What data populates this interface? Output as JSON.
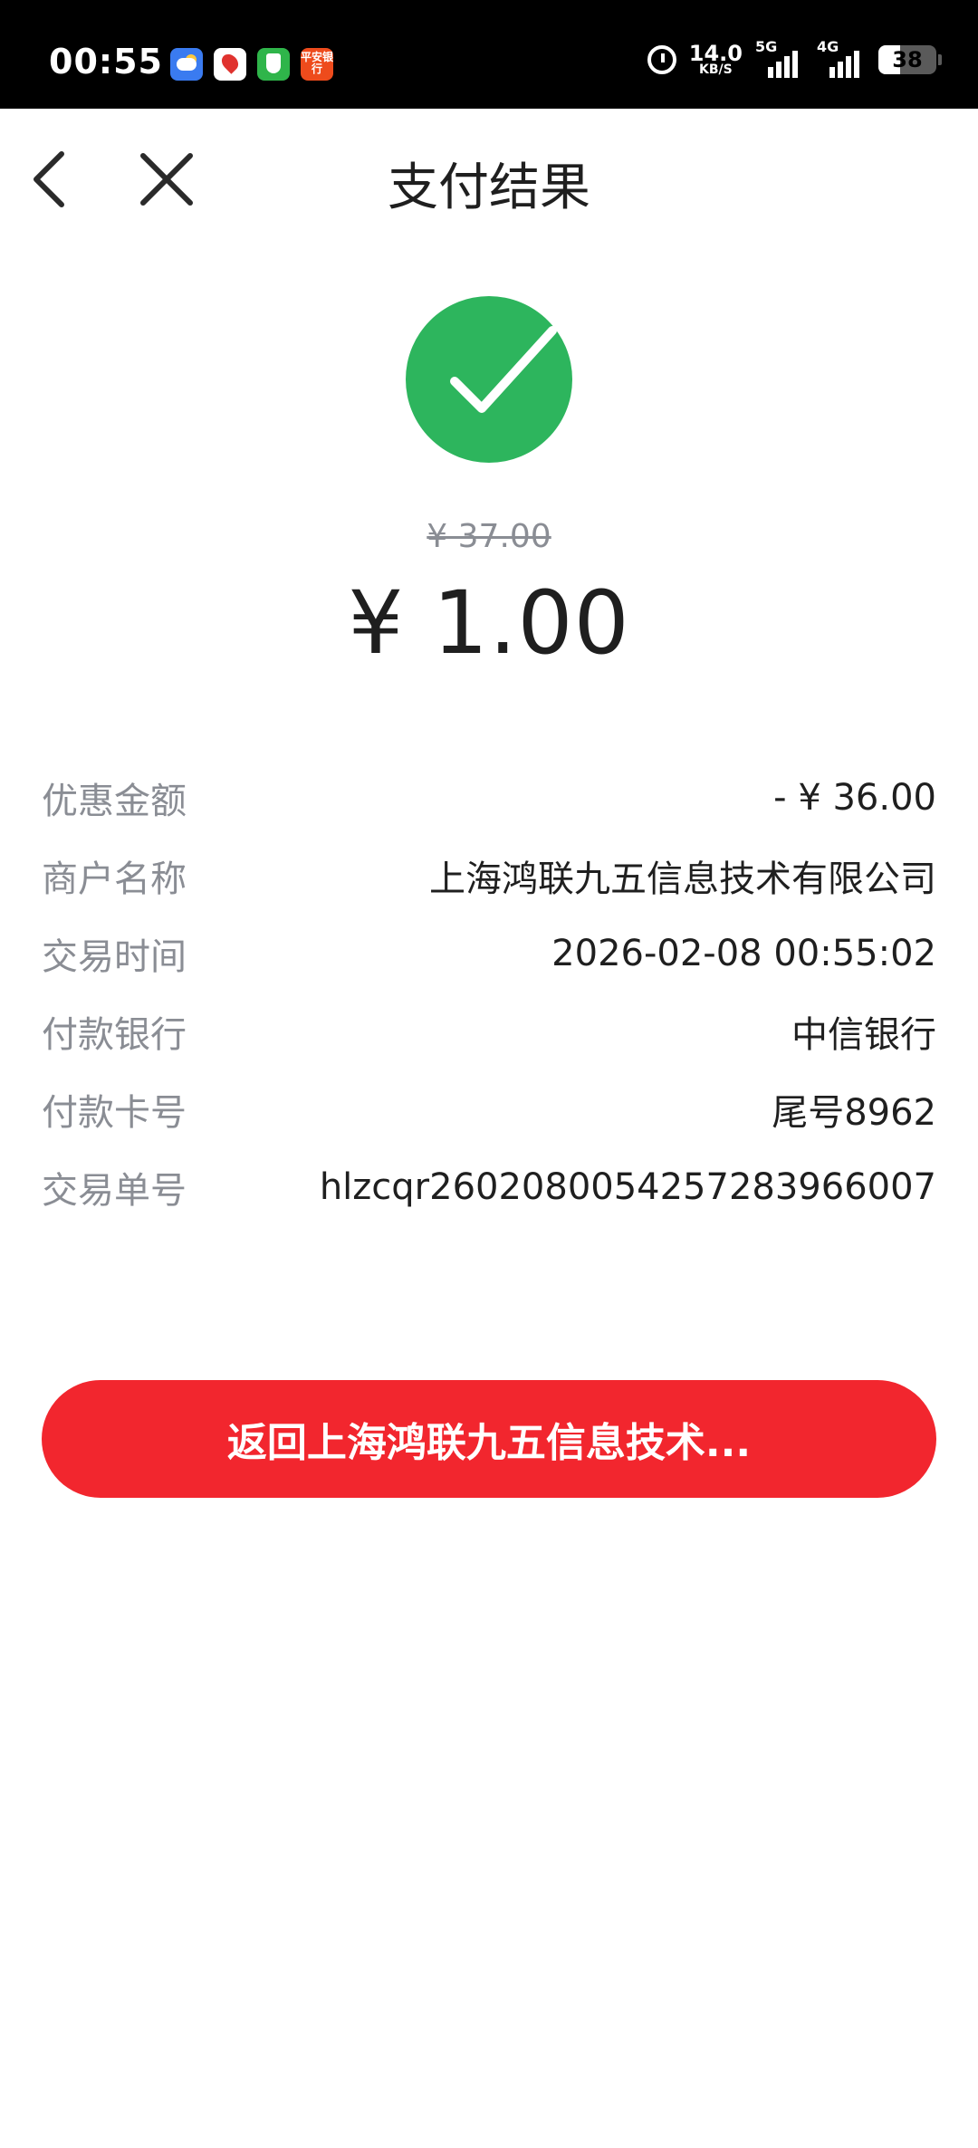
{
  "status_bar": {
    "time": "00:55",
    "bank_app_text": "平安银行",
    "net_speed": "14.0",
    "net_speed_unit": "KB/S",
    "network_1": "5G",
    "network_2": "4G",
    "battery": "38"
  },
  "nav": {
    "title": "支付结果",
    "back_icon": "chevron-left-icon",
    "close_icon": "close-icon"
  },
  "result": {
    "status_icon": "check-circle-icon",
    "original_amount": "¥ 37.00",
    "amount": "¥ 1.00"
  },
  "details": [
    {
      "label": "优惠金额",
      "value": "- ¥ 36.00"
    },
    {
      "label": "商户名称",
      "value": "上海鸿联九五信息技术有限公司"
    },
    {
      "label": "交易时间",
      "value": "2026-02-08 00:55:02"
    },
    {
      "label": "付款银行",
      "value": "中信银行"
    },
    {
      "label": "付款卡号",
      "value": "尾号8962"
    },
    {
      "label": "交易单号",
      "value": "hlzcqr2602080054257283966007"
    }
  ],
  "return_button": {
    "label": "返回上海鸿联九五信息技术..."
  },
  "colors": {
    "success": "#2db55d",
    "primary": "#f2262e",
    "label_gray": "#8a8d94"
  }
}
